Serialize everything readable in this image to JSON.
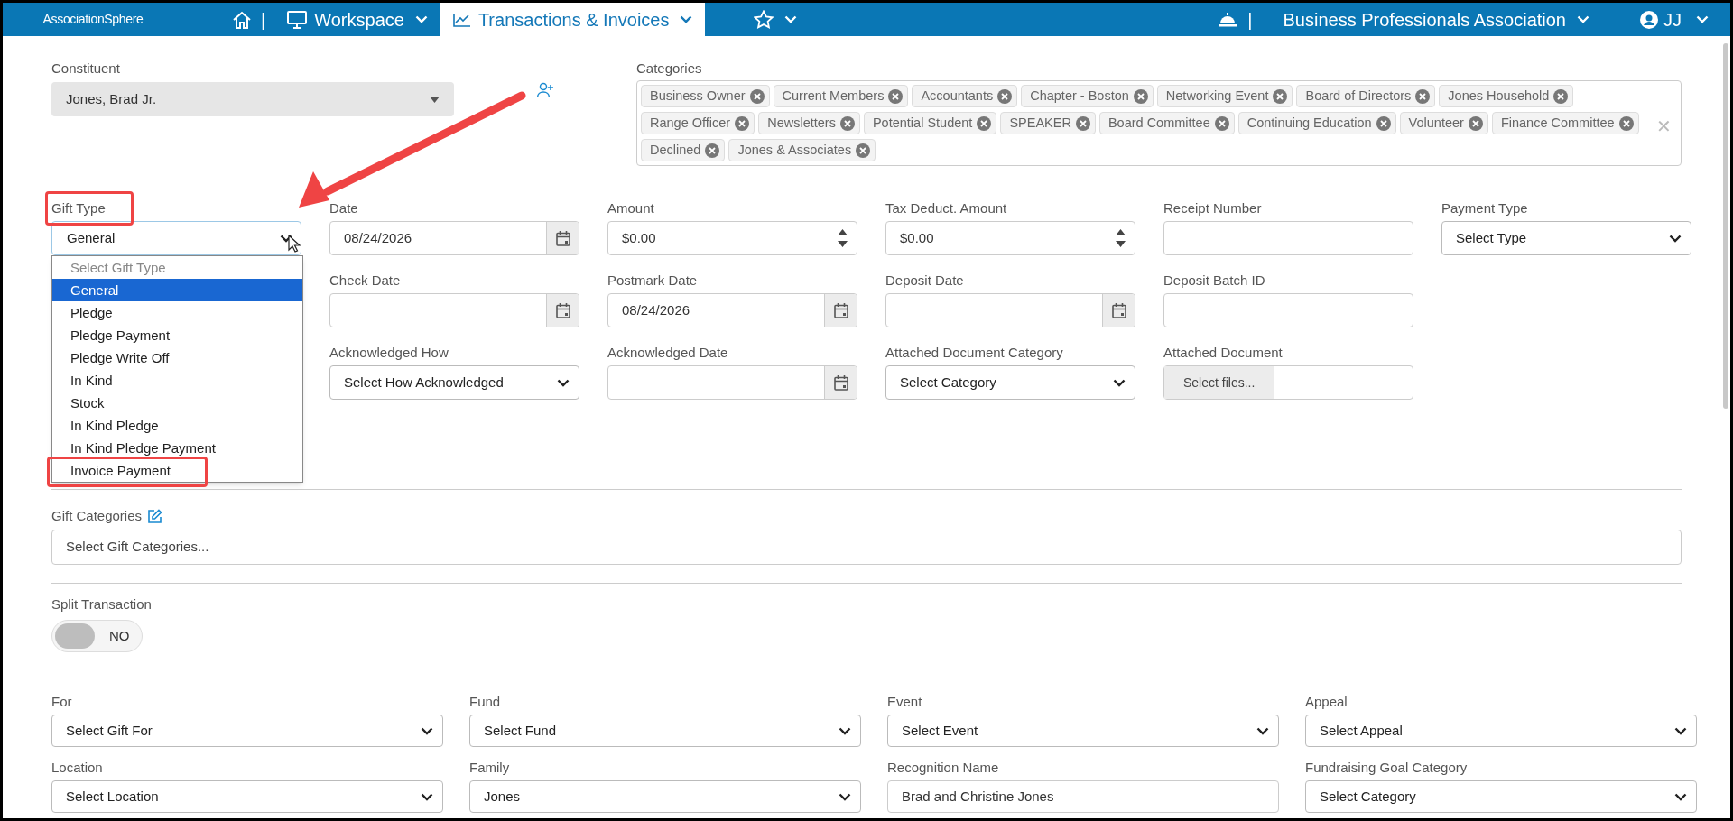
{
  "nav": {
    "logo": "AssociationSphere",
    "separator_left": "|",
    "menus": [
      {
        "label": "Workspace",
        "kind": "workspace",
        "selected": false
      },
      {
        "label": "Transactions & Invoices",
        "kind": "transactions",
        "selected": true
      },
      {
        "kind": "favorites",
        "selected": false
      }
    ],
    "separator_right": "|",
    "organization": "Business Professionals Association",
    "user": "JJ"
  },
  "constituent": {
    "label": "Constituent",
    "value": "Jones, Brad Jr."
  },
  "categories": {
    "label": "Categories",
    "tags": [
      "Business Owner",
      "Current Members",
      "Accountants",
      "Chapter - Boston",
      "Networking Event",
      "Board of Directors",
      "Jones Household",
      "Range Officer",
      "Newsletters",
      "Potential Student",
      "SPEAKER",
      "Board Committee",
      "Continuing Education",
      "Volunteer",
      "Finance Committee",
      "Declined",
      "Jones & Associates"
    ],
    "clear_symbol": "✕"
  },
  "gift_type": {
    "label": "Gift Type",
    "value": "General",
    "expanded": true,
    "placeholder": "Select Gift Type",
    "options": [
      {
        "label": "General",
        "selected": true
      },
      {
        "label": "Pledge",
        "selected": false
      },
      {
        "label": "Pledge Payment",
        "selected": false
      },
      {
        "label": "Pledge Write Off",
        "selected": false
      },
      {
        "label": "In Kind",
        "selected": false
      },
      {
        "label": "Stock",
        "selected": false
      },
      {
        "label": "In Kind Pledge",
        "selected": false
      },
      {
        "label": "In Kind Pledge Payment",
        "selected": false
      },
      {
        "label": "Invoice Payment",
        "selected": false
      }
    ]
  },
  "field_rows": [
    [
      {
        "label": "Date",
        "kind": "date",
        "value": "08/24/2026"
      },
      {
        "label": "Amount",
        "kind": "number",
        "value": "$0.00"
      },
      {
        "label": "Tax Deduct. Amount",
        "kind": "number",
        "value": "$0.00"
      },
      {
        "label": "Receipt Number",
        "kind": "text"
      },
      {
        "label": "Payment Type",
        "kind": "select",
        "value": "Select Type"
      }
    ],
    [
      {
        "label": "Check Date",
        "kind": "date"
      },
      {
        "label": "Postmark Date",
        "kind": "date",
        "value": "08/24/2026"
      },
      {
        "label": "Deposit Date",
        "kind": "date"
      },
      {
        "label": "Deposit Batch ID",
        "kind": "text"
      }
    ],
    [
      {
        "label": "Acknowledged How",
        "kind": "select",
        "value": "Select How Acknowledged"
      },
      {
        "label": "Acknowledged Date",
        "kind": "date"
      },
      {
        "label": "Attached Document Category",
        "kind": "select",
        "value": "Select Category"
      },
      {
        "label": "Attached Document",
        "kind": "file",
        "value": "Select files..."
      }
    ]
  ],
  "gift_categories": {
    "label": "Gift Categories",
    "placeholder": "Select Gift Categories..."
  },
  "split_transaction": {
    "label": "Split Transaction",
    "on": false,
    "text": "NO"
  },
  "bottom_rows": [
    [
      {
        "label": "For",
        "kind": "select",
        "value": "Select Gift For"
      },
      {
        "label": "Fund",
        "kind": "select",
        "value": "Select Fund"
      },
      {
        "label": "Event",
        "kind": "select",
        "value": "Select Event"
      },
      {
        "label": "Appeal",
        "kind": "select",
        "value": "Select Appeal"
      }
    ],
    [
      {
        "label": "Location",
        "kind": "select",
        "value": "Select Location"
      },
      {
        "label": "Family",
        "kind": "select",
        "value": "Jones"
      },
      {
        "label": "Recognition Name",
        "kind": "text",
        "value": "Brad and Christine Jones"
      },
      {
        "label": "Fundraising Goal Category",
        "kind": "select",
        "value": "Select Category"
      }
    ]
  ]
}
